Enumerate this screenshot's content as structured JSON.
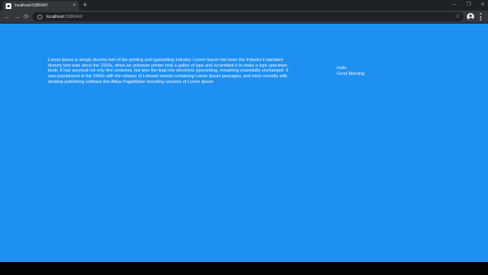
{
  "browser": {
    "tab_title": "localhost:53864/#/",
    "tab_close": "×",
    "new_tab": "+",
    "window_controls": [
      "—",
      "❐",
      "✕"
    ],
    "nav": {
      "back": "←",
      "forward": "→",
      "reload": "⟳"
    },
    "url_host": "localhost",
    "url_rest": ":53864/#/",
    "icons": [
      "info-icon",
      "star-icon",
      "avatar-icon",
      "menu-icon"
    ]
  },
  "page": {
    "background": "#1e90f2",
    "main_text": "Lorem Ipsum is simply dummy text of the printing and typesetting industry. Lorem Ipsum has been the industry's standard dummy text ever since the 1500s, when an unknown printer took a galley of type and scrambled it to make a type specimen book. It has survived not only five centuries, but also the leap into electronic typesetting, remaining essentially unchanged. It was popularised in the 1960s with the release of Letraset sheets containing Lorem Ipsum passages, and more recently with desktop publishing software like Aldus PageMaker including versions of Lorem Ipsum",
    "greeting_line1": "Hello",
    "greeting_line2": "Good Morning"
  }
}
